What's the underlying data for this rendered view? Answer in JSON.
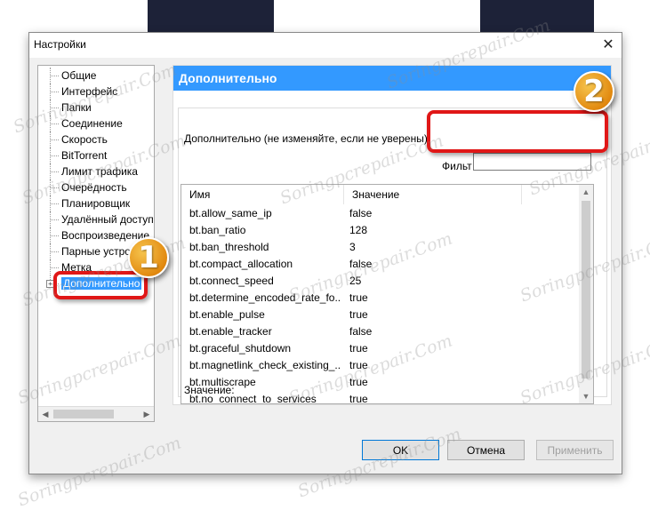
{
  "window": {
    "title": "Настройки"
  },
  "sidebar": {
    "items": [
      {
        "label": "Общие"
      },
      {
        "label": "Интерфейс"
      },
      {
        "label": "Папки"
      },
      {
        "label": "Соединение"
      },
      {
        "label": "Скорость"
      },
      {
        "label": "BitTorrent"
      },
      {
        "label": "Лимит трафика"
      },
      {
        "label": "Очерёдность"
      },
      {
        "label": "Планировщик"
      },
      {
        "label": "Удалённый доступ"
      },
      {
        "label": "Воспроизведение"
      },
      {
        "label": "Парные устро"
      },
      {
        "label": "Метка"
      },
      {
        "label": "Дополнительно",
        "selected": true
      }
    ]
  },
  "panel": {
    "header": "Дополнительно",
    "group_caption": "Дополнительно (не изменяйте, если не уверены)",
    "filter_label": "Фильт",
    "filter_value": "",
    "columns": [
      "Имя",
      "Значение"
    ],
    "rows": [
      {
        "name": "bt.allow_same_ip",
        "value": "false"
      },
      {
        "name": "bt.ban_ratio",
        "value": "128"
      },
      {
        "name": "bt.ban_threshold",
        "value": "3"
      },
      {
        "name": "bt.compact_allocation",
        "value": "false"
      },
      {
        "name": "bt.connect_speed",
        "value": "25"
      },
      {
        "name": "bt.determine_encoded_rate_fo...",
        "value": "true"
      },
      {
        "name": "bt.enable_pulse",
        "value": "true"
      },
      {
        "name": "bt.enable_tracker",
        "value": "false"
      },
      {
        "name": "bt.graceful_shutdown",
        "value": "true"
      },
      {
        "name": "bt.magnetlink_check_existing_...",
        "value": "true"
      },
      {
        "name": "bt.multiscrape",
        "value": "true"
      },
      {
        "name": "bt.no_connect_to_services",
        "value": "true"
      }
    ],
    "value_label": "Значение:"
  },
  "buttons": {
    "ok": "OK",
    "cancel": "Отмена",
    "apply": "Применить"
  },
  "annotations": {
    "badge1": "1",
    "badge2": "2",
    "color": "#e01717"
  },
  "watermark": "Soringpcrepair.Com"
}
